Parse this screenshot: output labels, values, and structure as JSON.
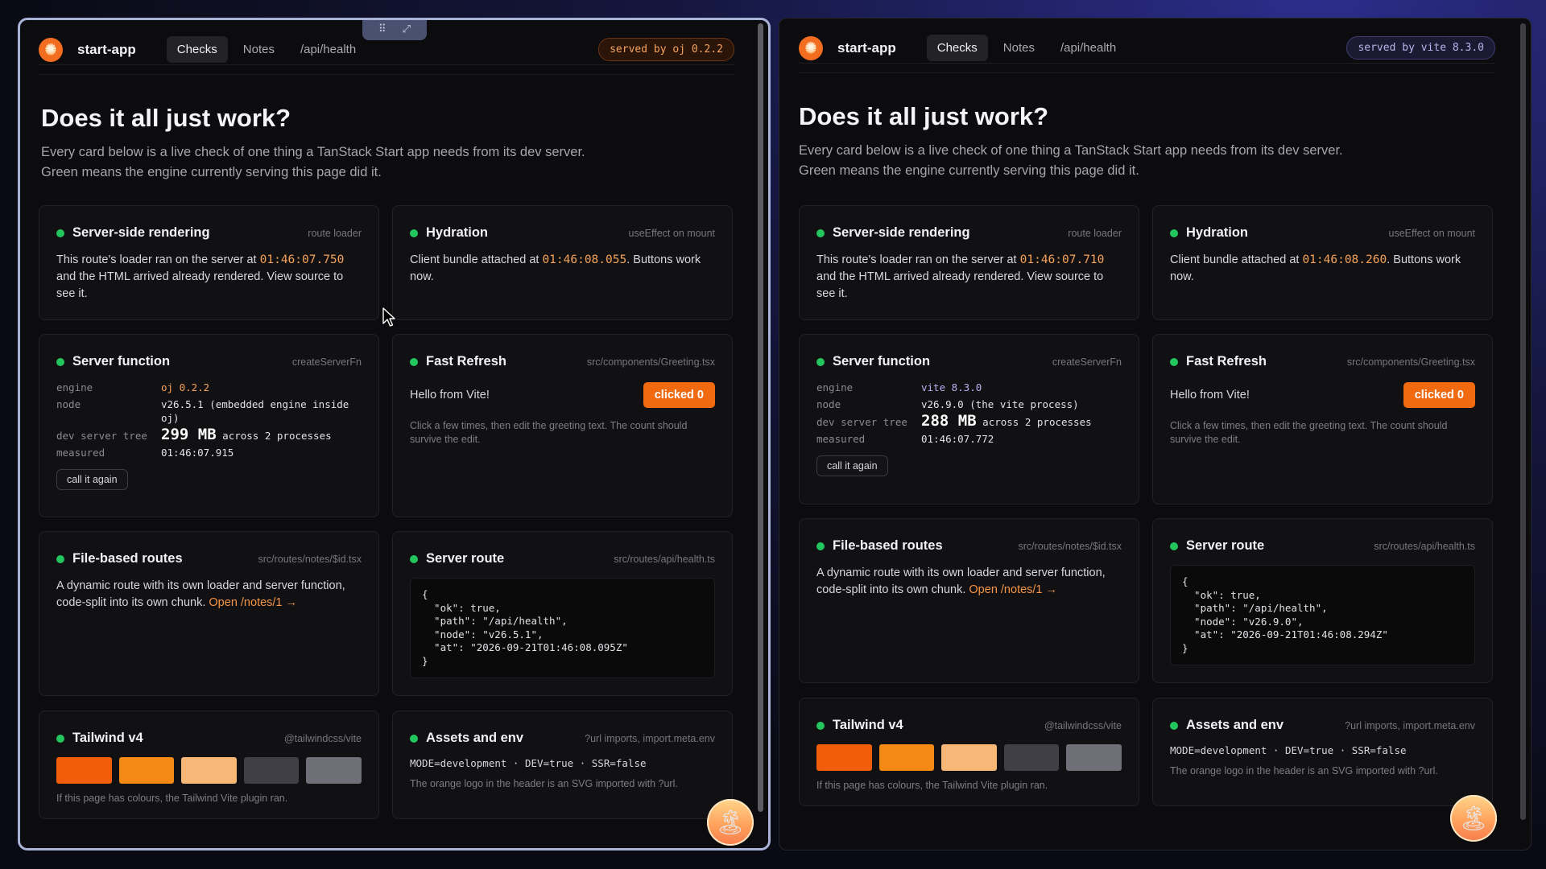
{
  "left": {
    "app_name": "start-app",
    "nav": [
      "Checks",
      "Notes",
      "/api/health"
    ],
    "served": "served by oj 0.2.2",
    "title": "Does it all just work?",
    "subtitle_1": "Every card below is a live check of one thing a TanStack Start app needs from its dev server.",
    "subtitle_2": "Green means the engine currently serving this page did it.",
    "ssr": {
      "title": "Server-side rendering",
      "tag": "route loader",
      "pre": "This route's loader ran on the server at ",
      "ts": "01:46:07.750",
      "post": " and the HTML arrived already rendered. View source to see it."
    },
    "hydration": {
      "title": "Hydration",
      "tag": "useEffect on mount",
      "pre": "Client bundle attached at ",
      "ts": "01:46:08.055",
      "post": ". Buttons work now."
    },
    "server_fn": {
      "title": "Server function",
      "tag": "createServerFn",
      "k_engine": "engine",
      "engine": "oj 0.2.2",
      "k_node": "node",
      "node": "v26.5.1 (embedded engine inside oj)",
      "k_tree": "dev server tree",
      "tree_size": "299 MB",
      "tree_rest": "across 2 processes",
      "k_measured": "measured",
      "measured": "01:46:07.915",
      "button": "call it again"
    },
    "fast_refresh": {
      "title": "Fast Refresh",
      "tag": "src/components/Greeting.tsx",
      "greeting": "Hello from Vite!",
      "button": "clicked 0",
      "hint": "Click a few times, then edit the greeting text. The count should survive the edit."
    },
    "routes": {
      "title": "File-based routes",
      "tag": "src/routes/notes/$id.tsx",
      "body": "A dynamic route with its own loader and server function, code-split into its own chunk. ",
      "link": "Open /notes/1 →"
    },
    "server_route": {
      "title": "Server route",
      "tag": "src/routes/api/health.ts",
      "json": "{\n  \"ok\": true,\n  \"path\": \"/api/health\",\n  \"node\": \"v26.5.1\",\n  \"at\": \"2026-09-21T01:46:08.095Z\"\n}"
    },
    "tailwind": {
      "title": "Tailwind v4",
      "tag": "@tailwindcss/vite",
      "hint": "If this page has colours, the Tailwind Vite plugin ran."
    },
    "assets": {
      "title": "Assets and env",
      "tag": "?url imports, import.meta.env",
      "env": "MODE=development · DEV=true · SSR=false",
      "hint": "The orange logo in the header is an SVG imported with ?url."
    }
  },
  "right": {
    "app_name": "start-app",
    "nav": [
      "Checks",
      "Notes",
      "/api/health"
    ],
    "served": "served by vite 8.3.0",
    "title": "Does it all just work?",
    "subtitle_1": "Every card below is a live check of one thing a TanStack Start app needs from its dev server.",
    "subtitle_2": "Green means the engine currently serving this page did it.",
    "ssr": {
      "title": "Server-side rendering",
      "tag": "route loader",
      "pre": "This route's loader ran on the server at ",
      "ts": "01:46:07.710",
      "post": " and the HTML arrived already rendered. View source to see it."
    },
    "hydration": {
      "title": "Hydration",
      "tag": "useEffect on mount",
      "pre": "Client bundle attached at ",
      "ts": "01:46:08.260",
      "post": ". Buttons work now."
    },
    "server_fn": {
      "title": "Server function",
      "tag": "createServerFn",
      "k_engine": "engine",
      "engine": "vite 8.3.0",
      "k_node": "node",
      "node": "v26.9.0 (the vite process)",
      "k_tree": "dev server tree",
      "tree_size": "288 MB",
      "tree_rest": "across 2 processes",
      "k_measured": "measured",
      "measured": "01:46:07.772",
      "button": "call it again"
    },
    "fast_refresh": {
      "title": "Fast Refresh",
      "tag": "src/components/Greeting.tsx",
      "greeting": "Hello from Vite!",
      "button": "clicked 0",
      "hint": "Click a few times, then edit the greeting text. The count should survive the edit."
    },
    "routes": {
      "title": "File-based routes",
      "tag": "src/routes/notes/$id.tsx",
      "body": "A dynamic route with its own loader and server function, code-split into its own chunk. ",
      "link": "Open /notes/1 →"
    },
    "server_route": {
      "title": "Server route",
      "tag": "src/routes/api/health.ts",
      "json": "{\n  \"ok\": true,\n  \"path\": \"/api/health\",\n  \"node\": \"v26.9.0\",\n  \"at\": \"2026-09-21T01:46:08.294Z\"\n}"
    },
    "tailwind": {
      "title": "Tailwind v4",
      "tag": "@tailwindcss/vite",
      "hint": "If this page has colours, the Tailwind Vite plugin ran."
    },
    "assets": {
      "title": "Assets and env",
      "tag": "?url imports, import.meta.env",
      "env": "MODE=development · DEV=true · SSR=false",
      "hint": "The orange logo in the header is an SVG imported with ?url."
    }
  },
  "colors": {
    "accent": "#f26a10",
    "ok": "#22c55e",
    "swatches": [
      "#f25d0c",
      "#f48a13",
      "#f7b877",
      "#3f3f45",
      "#6f6f77"
    ]
  },
  "icons": {
    "logo": "orange-sun-logo-icon",
    "palm": "palm-tree-badge-icon",
    "drag": "drag-grip-icon",
    "expand": "expand-icon",
    "cursor": "mouse-pointer-icon"
  }
}
